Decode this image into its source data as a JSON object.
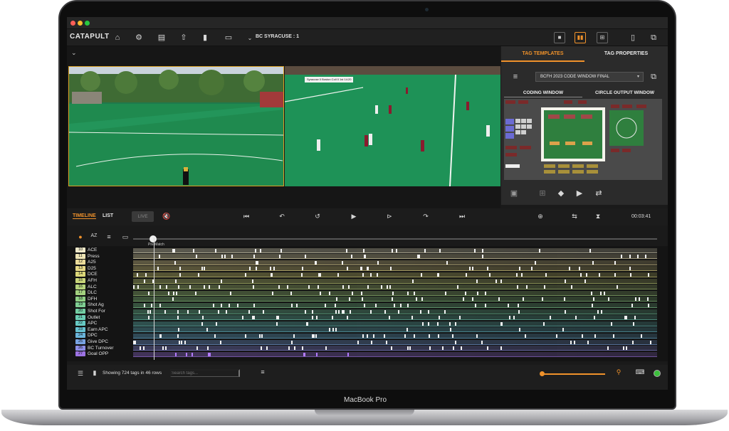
{
  "device": {
    "model": "MacBook Pro"
  },
  "app": {
    "logo": "CATAPULT",
    "match_title": "BC SYRACUSE : 1",
    "toolbar_icons": [
      "home-icon",
      "gear-icon",
      "layers-icon",
      "upload-icon",
      "book-icon",
      "monitor-icon"
    ],
    "layout_icons": [
      "single-view-icon",
      "split-view-icon",
      "grid-view-icon",
      "tablet-icon",
      "external-window-icon"
    ]
  },
  "video": {
    "scorebug": "Syracuse  0  Boston Coll  0  1st  14:20"
  },
  "panel": {
    "tabs": {
      "templates": "TAG TEMPLATES",
      "properties": "TAG PROPERTIES"
    },
    "template_select": "BCFH 2023 CODE WINDOW FINAL",
    "subtabs": {
      "coding": "CODING WINDOW",
      "circle": "CIRCLE OUTPUT WINDOW"
    },
    "active_color": "#f0922b"
  },
  "timeline": {
    "tabs": {
      "timeline": "TIMELINE",
      "list": "LIST"
    },
    "live_label": "LIVE",
    "timecode": "00:03:41",
    "marker_label": "Pre Match",
    "rows": [
      {
        "num": "10",
        "label": "ACE",
        "color": "#efe9c9"
      },
      {
        "num": "11",
        "label": "Press",
        "color": "#efe5b5"
      },
      {
        "num": "12",
        "label": "A25",
        "color": "#ecdc9a"
      },
      {
        "num": "13",
        "label": "D25",
        "color": "#e6d886"
      },
      {
        "num": "14",
        "label": "DCE",
        "color": "#dcd879"
      },
      {
        "num": "15",
        "label": "AFH",
        "color": "#c9d57a"
      },
      {
        "num": "16",
        "label": "ALC",
        "color": "#b5d27c"
      },
      {
        "num": "17",
        "label": "DLC",
        "color": "#a3d17f"
      },
      {
        "num": "18",
        "label": "DFH",
        "color": "#8ecf84"
      },
      {
        "num": "19",
        "label": "Shot Ag",
        "color": "#7fcf93"
      },
      {
        "num": "20",
        "label": "Shot For",
        "color": "#73cea3"
      },
      {
        "num": "21",
        "label": "Outlet",
        "color": "#6bcdb4"
      },
      {
        "num": "22",
        "label": "APC",
        "color": "#67c9c3"
      },
      {
        "num": "23",
        "label": "Earn APC",
        "color": "#66c1d1"
      },
      {
        "num": "24",
        "label": "DPC",
        "color": "#6ab5dc"
      },
      {
        "num": "25",
        "label": "Give DPC",
        "color": "#78a3e3"
      },
      {
        "num": "26",
        "label": "BC Turnover",
        "color": "#8c8de6"
      },
      {
        "num": "27",
        "label": "Goal OPP",
        "color": "#9d73e4"
      }
    ]
  },
  "footer": {
    "status": "Showing 724 tags in 46 rows",
    "search_placeholder": "Search tags..."
  }
}
